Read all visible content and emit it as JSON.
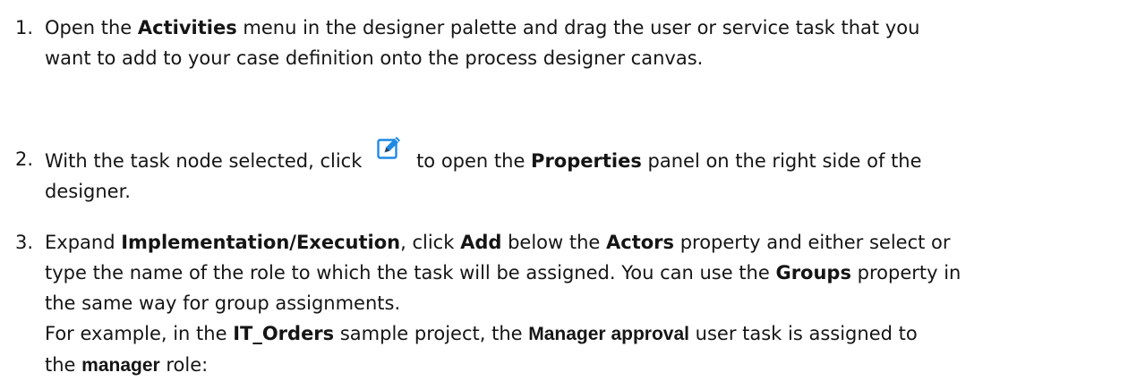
{
  "steps": [
    {
      "number": "1.",
      "lines": [
        [
          "Open the ",
          "Activities",
          " menu in the designer palette and drag the user or service task that you"
        ],
        [
          "want to add to your case definition onto the process designer canvas."
        ]
      ]
    },
    {
      "number": "2.",
      "lines": [
        [
          "With the task node selected, click ",
          "to open the ",
          "Properties",
          " panel on the right side of the"
        ],
        [
          "designer."
        ]
      ],
      "icon": "edit-icon"
    },
    {
      "number": "3.",
      "lines": [
        [
          "Expand ",
          "Implementation/Execution",
          ", click ",
          "Add",
          " below the ",
          "Actors",
          " property and either select or"
        ],
        [
          "type the name of the role to which the task will be assigned. You can use the ",
          "Groups",
          " property in"
        ],
        [
          "the same way for group assignments."
        ],
        [
          "For example, in the ",
          "IT_Orders",
          " sample project, the ",
          "Manager approval",
          " user task is assigned to"
        ],
        [
          "the ",
          "manager",
          " role:"
        ]
      ]
    }
  ],
  "colors": {
    "text": "#151515",
    "icon_blue": "#1e88e5",
    "icon_dark": "#3a3a3a"
  }
}
